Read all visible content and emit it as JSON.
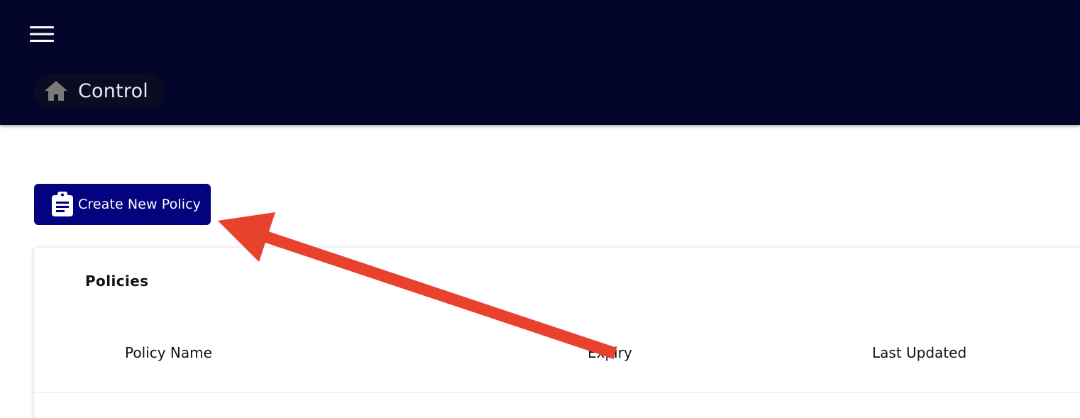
{
  "app_bar": {
    "menu_icon": "hamburger-menu-icon",
    "breadcrumb": {
      "icon": "home-icon",
      "label": "Control"
    },
    "colors": {
      "background": "#03052b",
      "chip_background": "#0a0c24",
      "home_icon": "#7a7a7a"
    }
  },
  "toolbar": {
    "create_button": {
      "icon": "clipboard-icon",
      "label": "Create New Policy",
      "color": "#04037f"
    }
  },
  "policies_table": {
    "title": "Policies",
    "columns": [
      "Policy Name",
      "Expiry",
      "Last Updated"
    ]
  },
  "annotation": {
    "type": "arrow",
    "color": "#e8412c",
    "points_to": "Create New Policy"
  }
}
